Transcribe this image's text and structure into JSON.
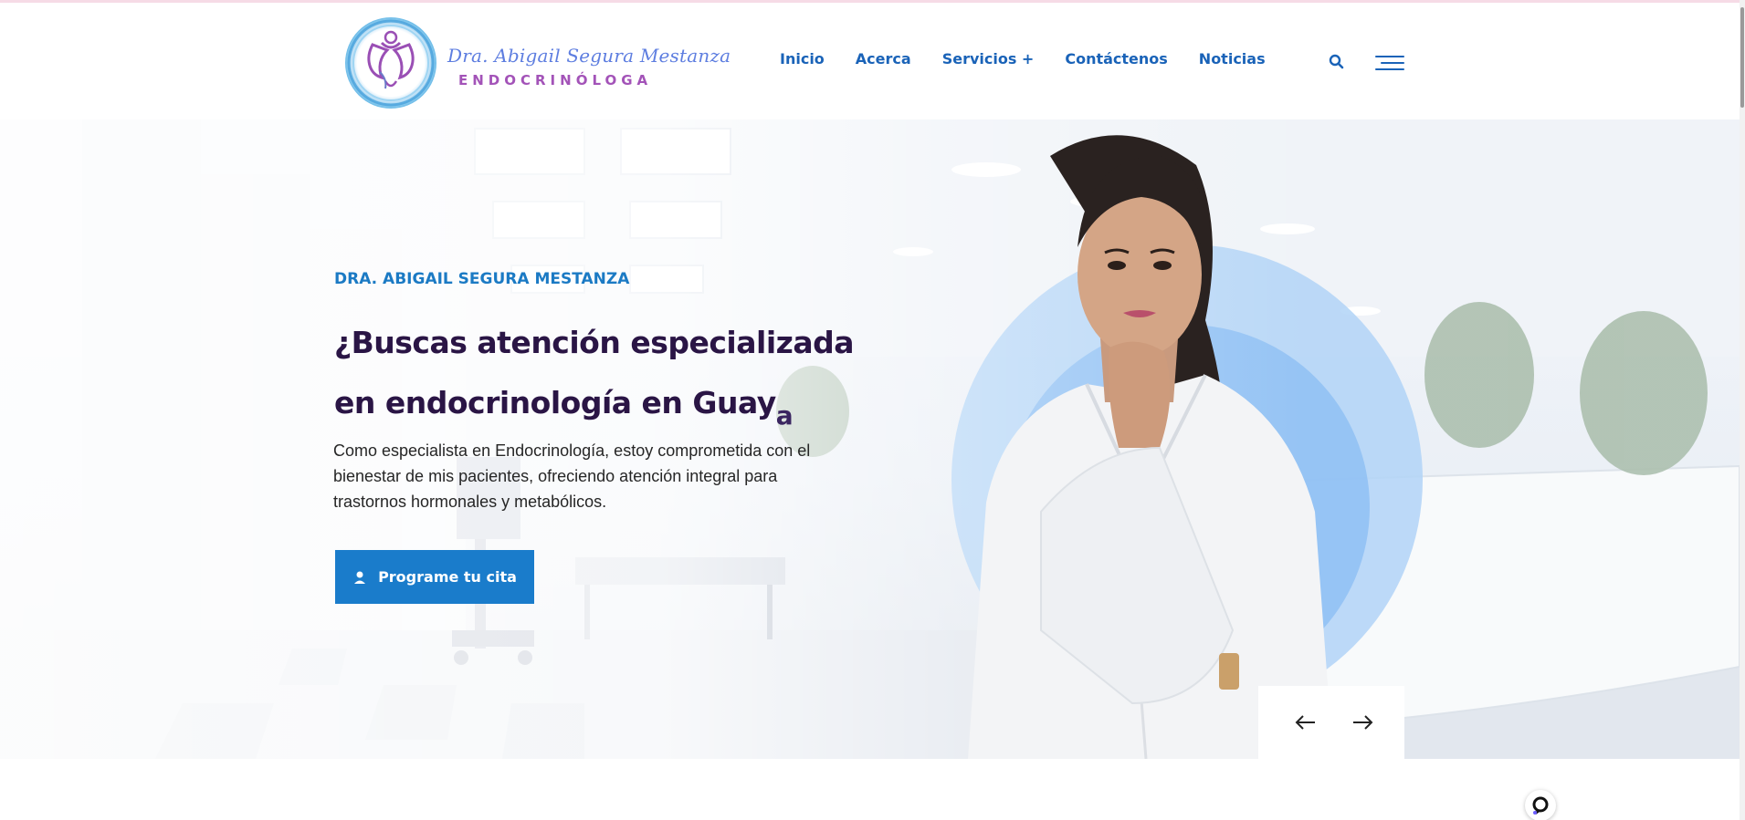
{
  "brand": {
    "name": "Dra. Abigail Segura Mestanza",
    "subtitle": "ENDOCRINÓLOGA"
  },
  "nav": {
    "items": [
      "Inicio",
      "Acerca",
      "Servicios +",
      "Contáctenos",
      "Noticias"
    ]
  },
  "icons": {
    "search": "search-icon",
    "menu": "hamburger-menu-icon",
    "prev": "arrow-left-icon",
    "next": "arrow-right-icon",
    "cta": "user-icon",
    "widget": "chat-widget-icon"
  },
  "hero": {
    "kicker": "DRA. ABIGAIL SEGURA MESTANZA",
    "headline": "¿Buscas atención especializada en endocrinología en Guay",
    "typing_char": "a",
    "lead": "Como especialista en Endocrinología, estoy comprometida con el bienestar de mis pacientes, ofreciendo atención integral para trastornos hormonales y metabólicos.",
    "cta_label": "Programe tu cita"
  },
  "colors": {
    "primary": "#1a7ccb",
    "nav": "#1a63b8",
    "kicker": "#1b7ac4",
    "headline": "#2a1545",
    "logo_purple": "#a353b8",
    "logo_blue": "#5e7ee0",
    "accent_circle": "#7fb8f5"
  }
}
